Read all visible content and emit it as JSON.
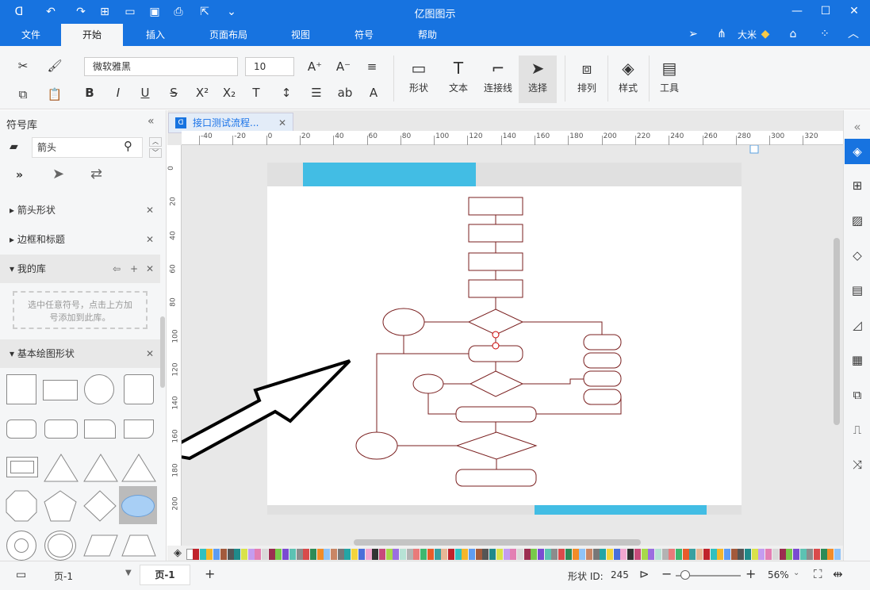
{
  "app": {
    "title": "亿图图示"
  },
  "tabs": [
    "文件",
    "开始",
    "插入",
    "页面布局",
    "视图",
    "符号",
    "帮助"
  ],
  "user": {
    "name": "大米"
  },
  "ribbon": {
    "font": "微软雅黑",
    "size": "10",
    "shape": "形状",
    "text": "文本",
    "connector": "连接线",
    "select": "选择",
    "arrange": "排列",
    "style": "样式",
    "tools": "工具"
  },
  "library": {
    "title": "符号库",
    "search": "箭头",
    "sections": [
      "箭头形状",
      "边框和标题"
    ],
    "my_lib": "我的库",
    "hint": "选中任意符号，点击上方加号添加到此库。",
    "basic": "基本绘图形状"
  },
  "doc": {
    "tab": "接口测试流程..."
  },
  "ruler": {
    "h": [
      "-40",
      "-20",
      "0",
      "20",
      "40",
      "60",
      "80",
      "100",
      "120",
      "140",
      "160",
      "180",
      "200",
      "220",
      "240",
      "260",
      "280",
      "300",
      "320"
    ],
    "v": [
      "0",
      "20",
      "40",
      "60",
      "80",
      "100",
      "120",
      "140",
      "160",
      "180",
      "200"
    ]
  },
  "status": {
    "page_sel": "页-1",
    "page_tab": "页-1",
    "shape_id_label": "形状 ID:",
    "shape_id": "245",
    "zoom": "56%"
  },
  "colors": {
    "brand": "#1773e0",
    "accent_bar": "#42bde4",
    "flow": "#7a1f1f"
  }
}
